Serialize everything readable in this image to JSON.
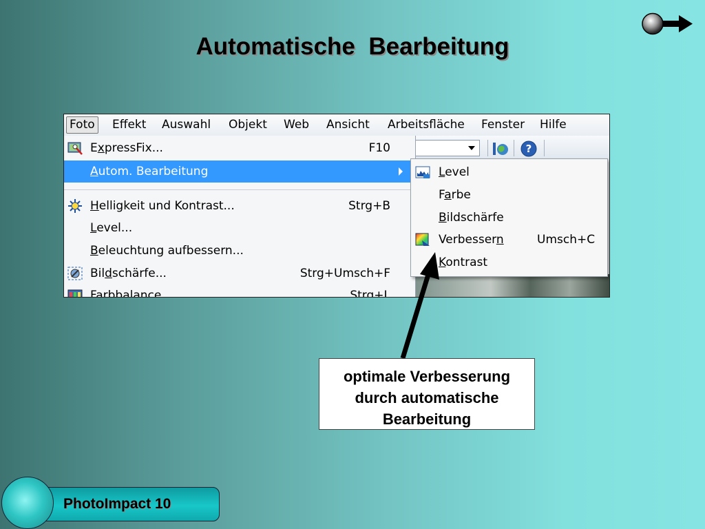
{
  "slide": {
    "title": "Automatische  Bearbeitung",
    "footer": "PhotoImpact 10",
    "callout_lines": [
      "optimale Verbesserung",
      "durch automatische",
      "Bearbeitung"
    ]
  },
  "menubar": [
    "Foto",
    "Effekt",
    "Auswahl",
    "Objekt",
    "Web",
    "Ansicht",
    "Arbeitsfläche",
    "Fenster",
    "Hilfe"
  ],
  "menu": {
    "expressfix": {
      "pre": "E",
      "u": "x",
      "post": "pressFix...",
      "shortcut": "F10",
      "icon": "expressfix-icon"
    },
    "autom": {
      "pre": "",
      "u": "A",
      "post": "utom. Bearbeitung"
    },
    "helligkeit": {
      "pre": "",
      "u": "H",
      "post": "elligkeit und Kontrast...",
      "shortcut": "Strg+B",
      "icon": "brightness-icon"
    },
    "level": {
      "pre": "",
      "u": "L",
      "post": "evel..."
    },
    "beleuchtung": {
      "pre": "",
      "u": "B",
      "post": "eleuchtung aufbessern..."
    },
    "bildschaerfe": {
      "pre": "Bil",
      "u": "d",
      "post": "schärfe...",
      "shortcut": "Strg+Umsch+F",
      "icon": "sharpness-icon"
    },
    "farbbalance": {
      "pre": "",
      "u": "F",
      "post": "arbbalance...",
      "shortcut": "Strg+L",
      "icon": "color-balance-icon"
    }
  },
  "submenu": {
    "level": {
      "pre": "",
      "u": "L",
      "post": "evel",
      "icon": "level-icon"
    },
    "farbe": {
      "pre": "F",
      "u": "a",
      "post": "rbe"
    },
    "bildschaerfe": {
      "pre": "",
      "u": "B",
      "post": "ildschärfe"
    },
    "verbessern": {
      "pre": "Verbesser",
      "u": "n",
      "post": "",
      "shortcut": "Umsch+C",
      "icon": "enhance-icon"
    },
    "kontrast": {
      "pre": "",
      "u": "K",
      "post": "ontrast"
    }
  },
  "colors": {
    "highlight": "#3399ff",
    "accent": "#86e4e2"
  }
}
